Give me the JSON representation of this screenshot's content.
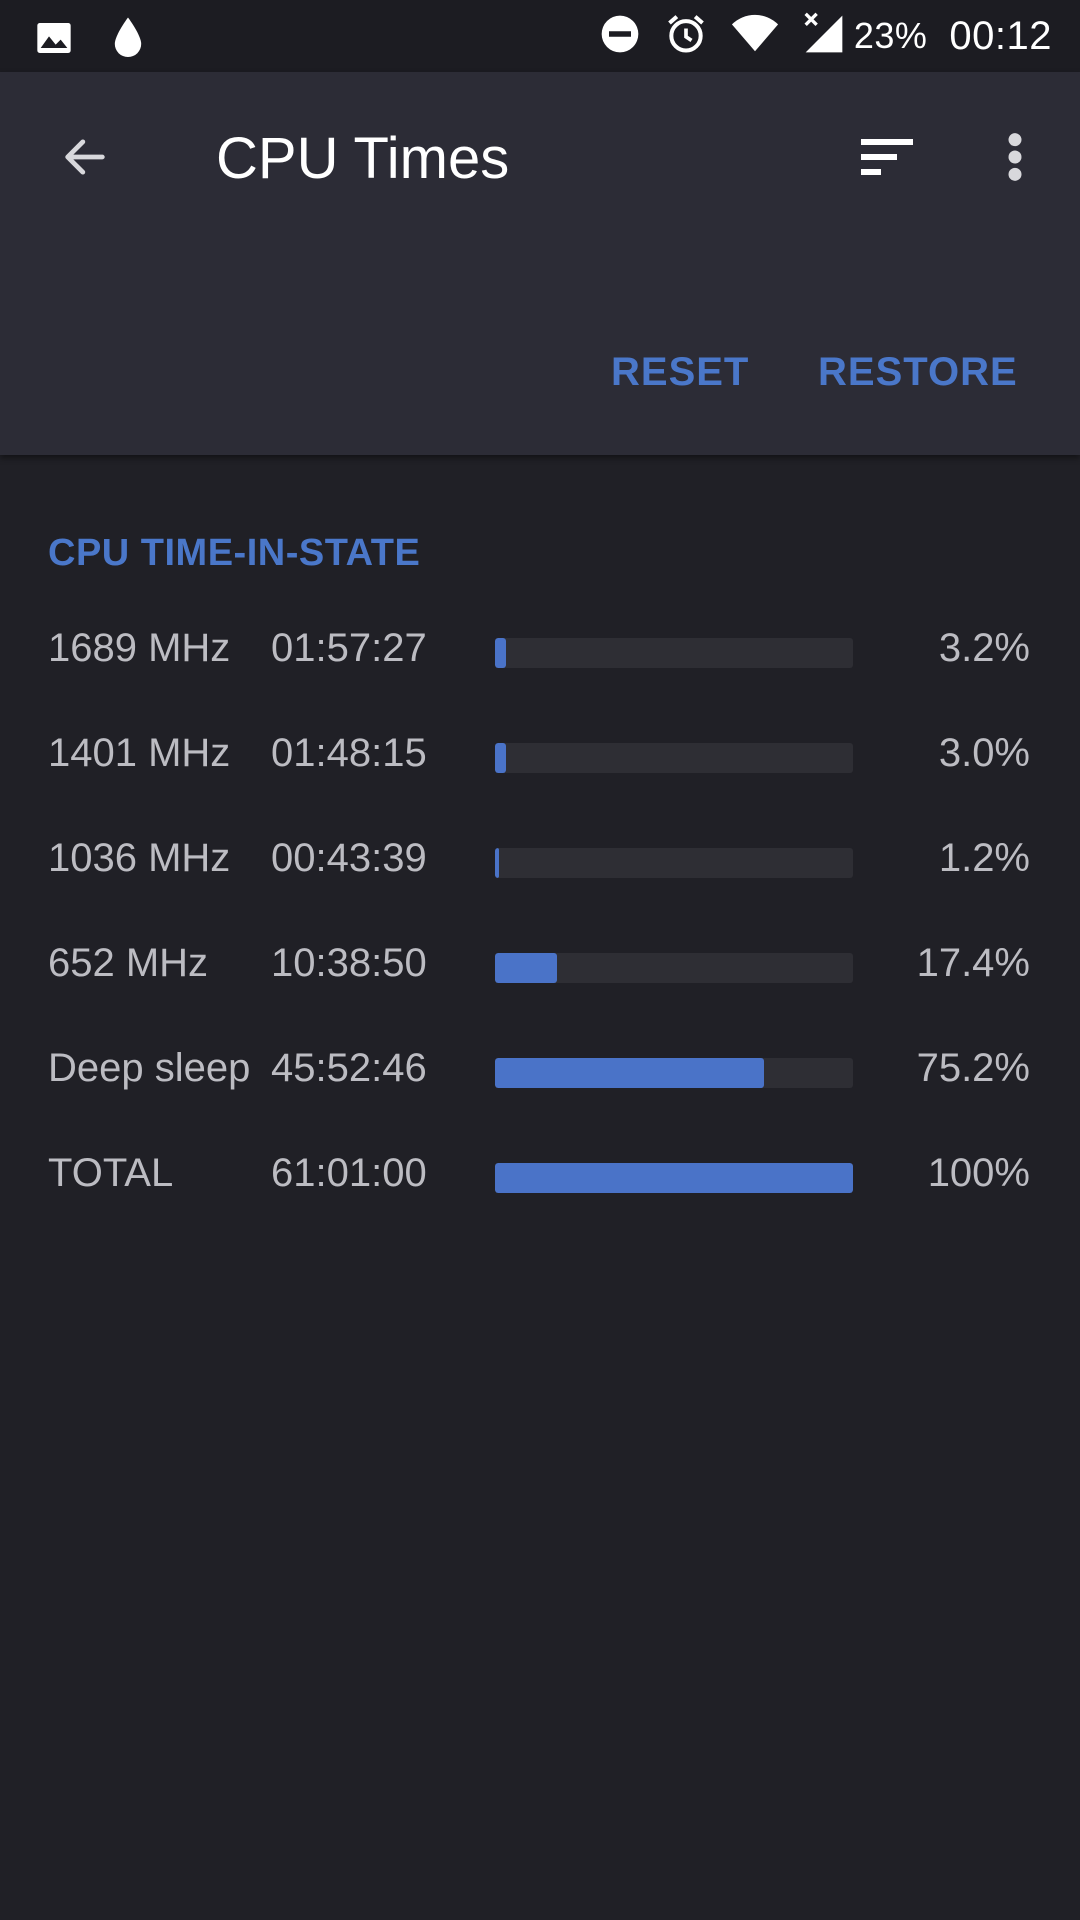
{
  "status_bar": {
    "icons_left": [
      "image-icon",
      "water-drop-icon"
    ],
    "icons_right": [
      "do-not-disturb-icon",
      "alarm-icon",
      "wifi-icon",
      "signal-icon"
    ],
    "battery": "23%",
    "time": "00:12"
  },
  "app_bar": {
    "title": "CPU Times",
    "reset_label": "RESET",
    "restore_label": "RESTORE"
  },
  "section": {
    "header": "CPU TIME-IN-STATE"
  },
  "states": [
    {
      "freq": "1689 MHz",
      "time": "01:57:27",
      "percent": "3.2%",
      "fill": 3.2
    },
    {
      "freq": "1401 MHz",
      "time": "01:48:15",
      "percent": "3.0%",
      "fill": 3.0
    },
    {
      "freq": "1036 MHz",
      "time": "00:43:39",
      "percent": "1.2%",
      "fill": 1.2
    },
    {
      "freq": "652 MHz",
      "time": "10:38:50",
      "percent": "17.4%",
      "fill": 17.4
    },
    {
      "freq": "Deep sleep",
      "time": "45:52:46",
      "percent": "75.2%",
      "fill": 75.2
    },
    {
      "freq": "TOTAL",
      "time": "61:01:00",
      "percent": "100%",
      "fill": 100
    }
  ],
  "colors": {
    "accent": "#4a77c9",
    "background": "#202026",
    "app_bar": "#2c2c36"
  }
}
